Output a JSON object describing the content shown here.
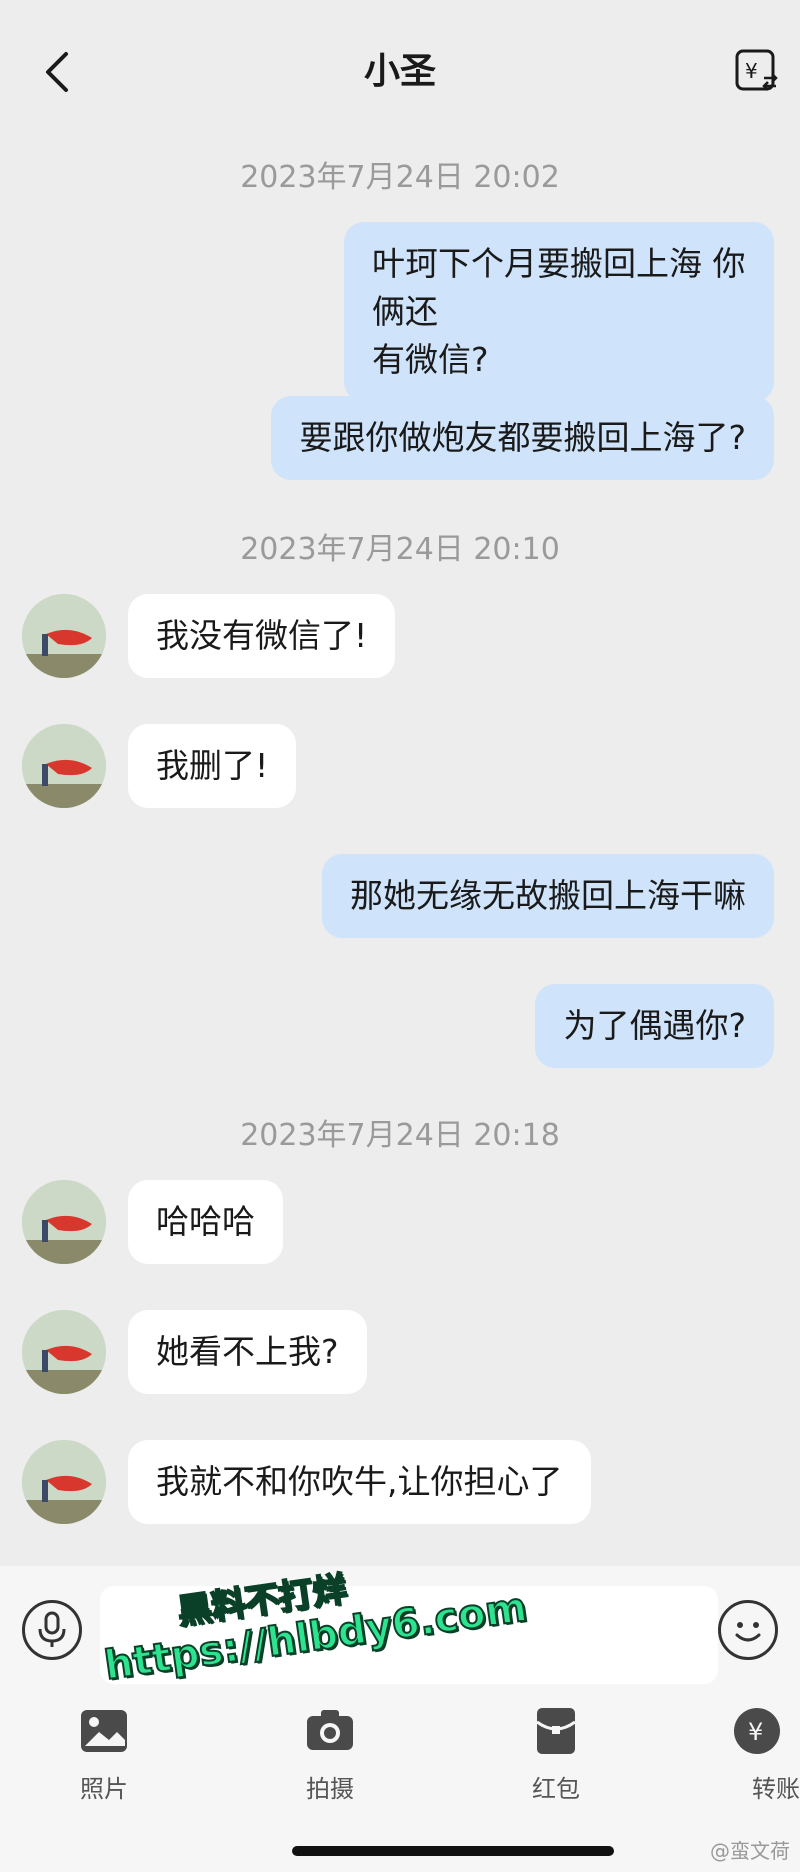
{
  "header": {
    "title": "小圣",
    "back_icon": "chevron-left-icon",
    "transfer_icon": "yen-transfer-icon"
  },
  "messages": [
    {
      "type": "timestamp",
      "text": "2023年7月24日 20:02"
    },
    {
      "type": "out",
      "text": "叶珂下个月要搬回上海 你俩还\n有微信?"
    },
    {
      "type": "out",
      "text": "要跟你做炮友都要搬回上海了?"
    },
    {
      "type": "timestamp",
      "text": "2023年7月24日 20:10"
    },
    {
      "type": "in",
      "text": "我没有微信了!"
    },
    {
      "type": "in",
      "text": "我删了!"
    },
    {
      "type": "out",
      "text": "那她无缘无故搬回上海干嘛"
    },
    {
      "type": "out",
      "text": "为了偶遇你?"
    },
    {
      "type": "timestamp",
      "text": "2023年7月24日 20:18"
    },
    {
      "type": "in",
      "text": "哈哈哈"
    },
    {
      "type": "in",
      "text": "她看不上我?"
    },
    {
      "type": "in",
      "text": "我就不和你吹牛,让你担心了"
    }
  ],
  "input": {
    "value": "",
    "mic_icon": "microphone-icon",
    "emoji_icon": "smiley-icon"
  },
  "toolbar": {
    "photo": "照片",
    "camera": "拍摄",
    "red_packet": "红包",
    "transfer": "转账"
  },
  "watermark": {
    "line1": "黑料不打烊",
    "line2": "https://hlbdy6.com"
  },
  "weibo_tag": "@蛮文荷",
  "colors": {
    "background": "#ededed",
    "outgoing_bubble": "#cfe4fb",
    "incoming_bubble": "#ffffff",
    "timestamp": "#9a9a9a"
  }
}
